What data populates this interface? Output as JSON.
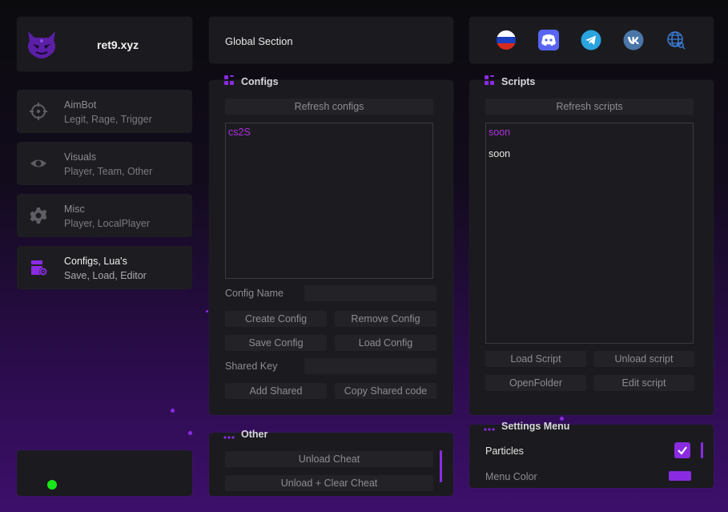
{
  "app": {
    "title": "ret9.xyz"
  },
  "sidebar": {
    "tabs": [
      {
        "title": "AimBot",
        "subtitle": "Legit, Rage, Trigger",
        "icon": "crosshair-icon"
      },
      {
        "title": "Visuals",
        "subtitle": "Player, Team, Other",
        "icon": "eye-icon"
      },
      {
        "title": "Misc",
        "subtitle": "Player, LocalPlayer",
        "icon": "gear-icon"
      },
      {
        "title": "Configs, Lua's",
        "subtitle": "Save, Load, Editor",
        "icon": "config-lua-icon",
        "active": true
      }
    ],
    "status": "online"
  },
  "global_section": {
    "label": "Global Section"
  },
  "social": [
    "russia-flag-icon",
    "discord-icon",
    "telegram-icon",
    "vk-icon",
    "globe-icon"
  ],
  "configs": {
    "header": "Configs",
    "refresh_label": "Refresh configs",
    "list": [
      "cs2S"
    ],
    "config_name_label": "Config Name",
    "config_name_value": "",
    "create_label": "Create Config",
    "remove_label": "Remove Config",
    "save_label": "Save Config",
    "load_label": "Load Config",
    "shared_key_label": "Shared Key",
    "shared_key_value": "",
    "add_shared_label": "Add Shared",
    "copy_shared_label": "Copy Shared code"
  },
  "scripts": {
    "header": "Scripts",
    "refresh_label": "Refresh scripts",
    "list": [
      "soon",
      "soon"
    ],
    "load_label": "Load Script",
    "unload_label": "Unload script",
    "open_folder_label": "OpenFolder",
    "edit_label": "Edit script"
  },
  "other": {
    "header": "Other",
    "unload_label": "Unload Cheat",
    "unload_clear_label": "Unload + Clear Cheat"
  },
  "settings": {
    "header": "Settings Menu",
    "particles_label": "Particles",
    "particles_checked": true,
    "menu_color_label": "Menu Color",
    "accent_color": "#8a2be2"
  },
  "colors": {
    "accent": "#8a2be2",
    "status": "#19e619",
    "selected_text": "#b030e0"
  }
}
